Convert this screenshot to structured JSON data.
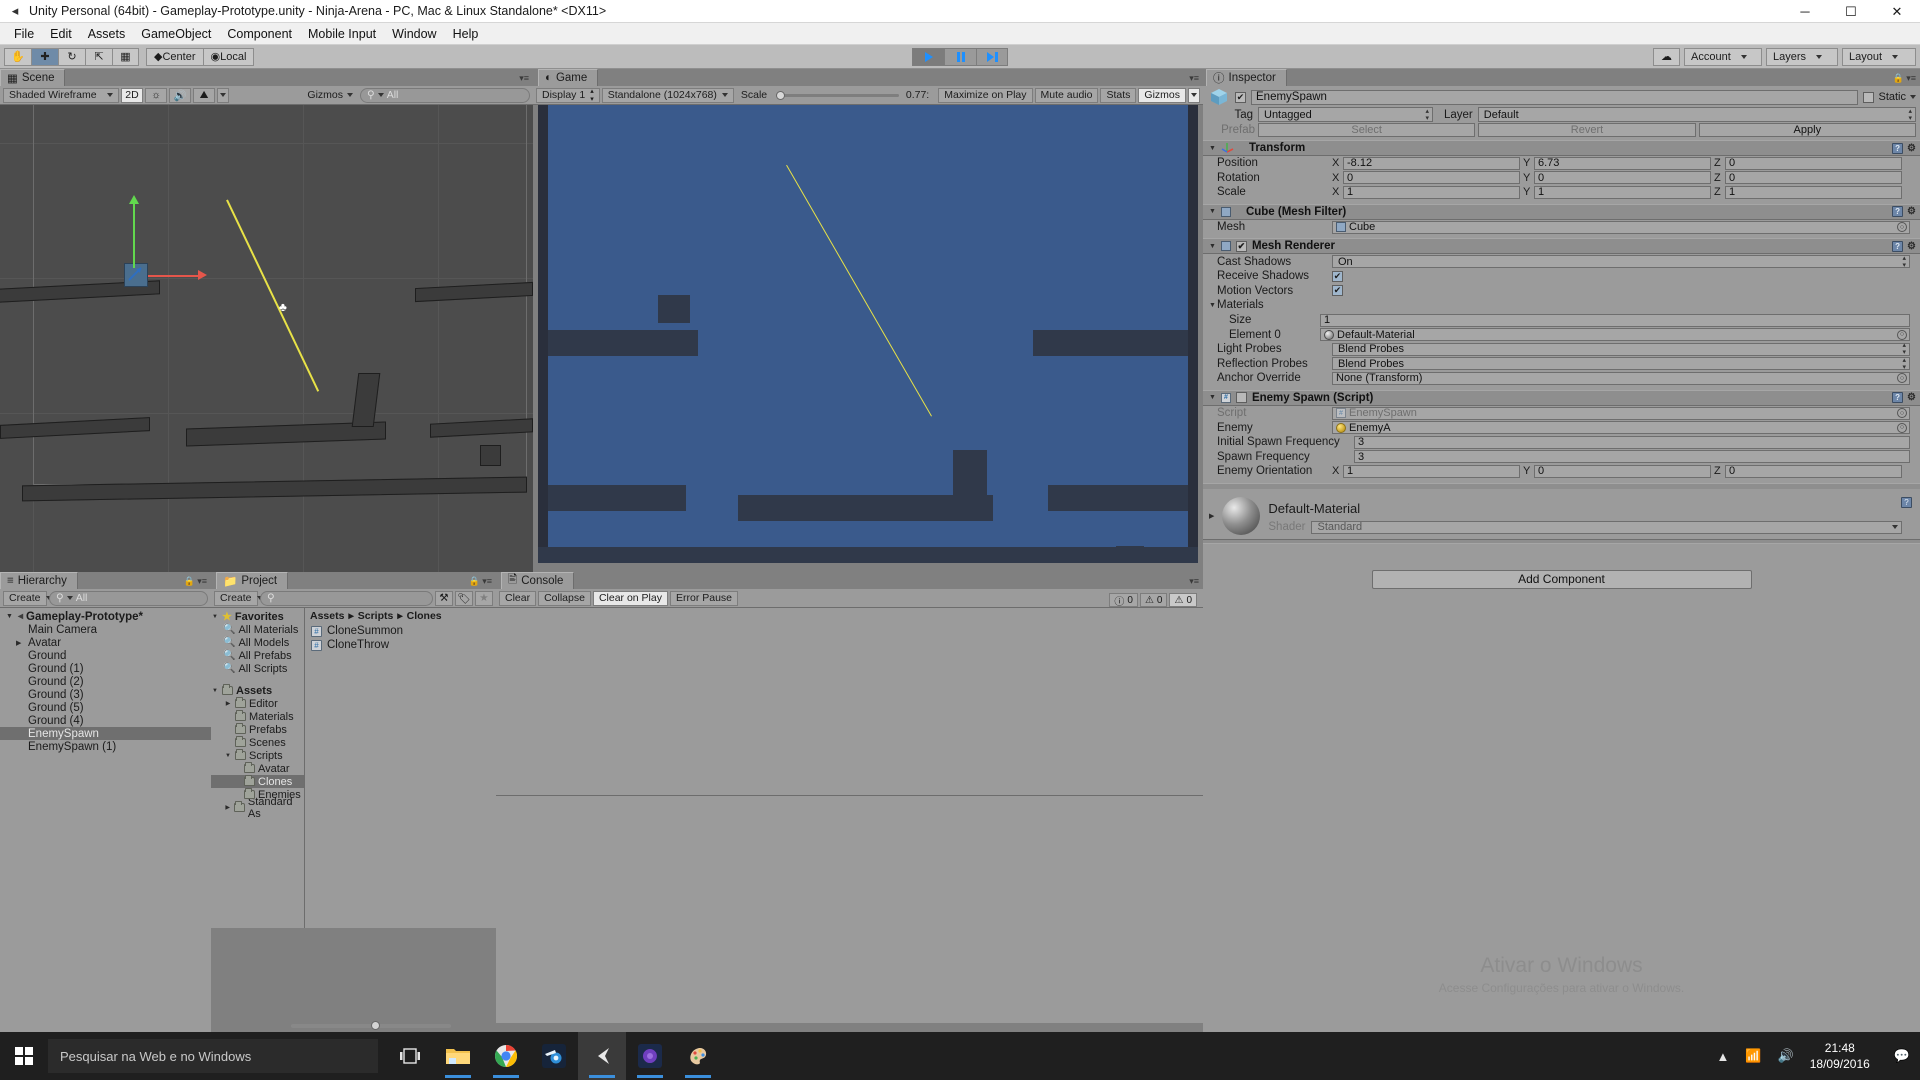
{
  "window": {
    "title": "Unity Personal (64bit) - Gameplay-Prototype.unity - Ninja-Arena - PC, Mac & Linux Standalone* <DX11>",
    "minimize": "─",
    "maximize": "☐",
    "close": "✕"
  },
  "menubar": {
    "items": [
      "File",
      "Edit",
      "Assets",
      "GameObject",
      "Component",
      "Mobile Input",
      "Window",
      "Help"
    ]
  },
  "toolbar": {
    "tools": [
      "hand-tool",
      "move-tool",
      "rotate-tool",
      "scale-tool",
      "rect-tool"
    ],
    "pivot_mode": "Center",
    "pivot_rotation": "Local",
    "play": "play-button",
    "pause": "pause-button",
    "step": "step-button",
    "cloud_label": "cloud-button",
    "account": "Account",
    "layers": "Layers",
    "layout": "Layout"
  },
  "scene": {
    "tab": "Scene",
    "draw_mode": "Shaded Wireframe",
    "mode_2d": "2D",
    "lighting_icon": "lighting-icon",
    "audio_icon": "audio-icon",
    "fx_icon": "effects-icon",
    "gizmos": "Gizmos",
    "search_placeholder": "All"
  },
  "game": {
    "tab": "Game",
    "display": "Display 1",
    "aspect": "Standalone (1024x768)",
    "scale_label": "Scale",
    "scale_value": "0.77:",
    "maximize_on_play": "Maximize on Play",
    "mute_audio": "Mute audio",
    "stats": "Stats",
    "gizmos": "Gizmos"
  },
  "hierarchy": {
    "tab": "Hierarchy",
    "create": "Create",
    "search_placeholder": "All",
    "scene_name": "Gameplay-Prototype*",
    "items": [
      {
        "label": "Main Camera",
        "indent": 1,
        "expandable": false,
        "selected": false
      },
      {
        "label": "Avatar",
        "indent": 1,
        "expandable": true,
        "selected": false
      },
      {
        "label": "Ground",
        "indent": 1,
        "expandable": false,
        "selected": false
      },
      {
        "label": "Ground (1)",
        "indent": 1,
        "expandable": false,
        "selected": false
      },
      {
        "label": "Ground (2)",
        "indent": 1,
        "expandable": false,
        "selected": false
      },
      {
        "label": "Ground (3)",
        "indent": 1,
        "expandable": false,
        "selected": false
      },
      {
        "label": "Ground (5)",
        "indent": 1,
        "expandable": false,
        "selected": false
      },
      {
        "label": "Ground (4)",
        "indent": 1,
        "expandable": false,
        "selected": false
      },
      {
        "label": "EnemySpawn",
        "indent": 1,
        "expandable": false,
        "selected": true
      },
      {
        "label": "EnemySpawn (1)",
        "indent": 1,
        "expandable": false,
        "selected": false
      }
    ]
  },
  "project": {
    "tab": "Project",
    "create": "Create",
    "search_placeholder": "",
    "favorites_label": "Favorites",
    "favorites": [
      "All Materials",
      "All Models",
      "All Prefabs",
      "All Scripts"
    ],
    "assets_label": "Assets",
    "tree": [
      {
        "label": "Editor",
        "indent": 1,
        "expandable": true,
        "selected": false
      },
      {
        "label": "Materials",
        "indent": 1,
        "expandable": false,
        "selected": false
      },
      {
        "label": "Prefabs",
        "indent": 1,
        "expandable": false,
        "selected": false
      },
      {
        "label": "Scenes",
        "indent": 1,
        "expandable": false,
        "selected": false
      },
      {
        "label": "Scripts",
        "indent": 1,
        "expandable": true,
        "expanded": true,
        "selected": false
      },
      {
        "label": "Avatar",
        "indent": 2,
        "expandable": false,
        "selected": false
      },
      {
        "label": "Clones",
        "indent": 2,
        "expandable": false,
        "selected": true
      },
      {
        "label": "Enemies",
        "indent": 2,
        "expandable": false,
        "selected": false
      },
      {
        "label": "Standard As",
        "indent": 1,
        "expandable": true,
        "selected": false
      }
    ],
    "breadcrumb": [
      "Assets",
      "Scripts",
      "Clones"
    ],
    "files": [
      {
        "name": "CloneSummon",
        "icon": "csharp-script-icon"
      },
      {
        "name": "CloneThrow",
        "icon": "csharp-script-icon"
      }
    ]
  },
  "console": {
    "tab": "Console",
    "clear": "Clear",
    "collapse": "Collapse",
    "clear_on_play": "Clear on Play",
    "error_pause": "Error Pause",
    "counts": {
      "log": "0",
      "warning": "0",
      "error": "0"
    }
  },
  "inspector": {
    "tab": "Inspector",
    "object_name": "EnemySpawn",
    "object_enabled": true,
    "static_label": "Static",
    "static_checked": false,
    "tag_label": "Tag",
    "tag_value": "Untagged",
    "layer_label": "Layer",
    "layer_value": "Default",
    "prefab_label": "Prefab",
    "prefab_select": "Select",
    "prefab_revert": "Revert",
    "prefab_apply": "Apply",
    "transform": {
      "title": "Transform",
      "position_label": "Position",
      "position": {
        "x": "-8.12",
        "y": "6.73",
        "z": "0"
      },
      "rotation_label": "Rotation",
      "rotation": {
        "x": "0",
        "y": "0",
        "z": "0"
      },
      "scale_label": "Scale",
      "scale": {
        "x": "1",
        "y": "1",
        "z": "1"
      }
    },
    "mesh_filter": {
      "title": "Cube (Mesh Filter)",
      "mesh_label": "Mesh",
      "mesh_value": "Cube"
    },
    "mesh_renderer": {
      "title": "Mesh Renderer",
      "enabled": true,
      "cast_shadows_label": "Cast Shadows",
      "cast_shadows_value": "On",
      "receive_shadows_label": "Receive Shadows",
      "receive_shadows_checked": true,
      "motion_vectors_label": "Motion Vectors",
      "motion_vectors_checked": true,
      "materials_label": "Materials",
      "size_label": "Size",
      "size_value": "1",
      "element0_label": "Element 0",
      "element0_value": "Default-Material",
      "light_probes_label": "Light Probes",
      "light_probes_value": "Blend Probes",
      "reflection_probes_label": "Reflection Probes",
      "reflection_probes_value": "Blend Probes",
      "anchor_override_label": "Anchor Override",
      "anchor_override_value": "None (Transform)"
    },
    "enemy_spawn_script": {
      "title": "Enemy Spawn (Script)",
      "enabled": false,
      "script_label": "Script",
      "script_value": "EnemySpawn",
      "enemy_label": "Enemy",
      "enemy_value": "EnemyA",
      "initial_spawn_frequency_label": "Initial Spawn Frequency",
      "initial_spawn_frequency_value": "3",
      "spawn_frequency_label": "Spawn Frequency",
      "spawn_frequency_value": "3",
      "enemy_orientation_label": "Enemy Orientation",
      "enemy_orientation": {
        "x": "1",
        "y": "0",
        "z": "0"
      }
    },
    "material_preview": {
      "name": "Default-Material",
      "shader_label": "Shader",
      "shader_value": "Standard"
    },
    "add_component": "Add Component",
    "watermark_line1": "Ativar o Windows",
    "watermark_line2": "Acesse Configurações para ativar o Windows."
  },
  "taskbar": {
    "search_placeholder": "Pesquisar na Web e no Windows",
    "icons": [
      "task-view-icon",
      "file-explorer-icon",
      "chrome-icon",
      "blender-icon",
      "unity-icon",
      "visual-studio-icon",
      "paint-icon"
    ],
    "tray": [
      "show-hidden-icons",
      "network-icon",
      "volume-icon"
    ],
    "time": "21:48",
    "date": "18/09/2016"
  }
}
